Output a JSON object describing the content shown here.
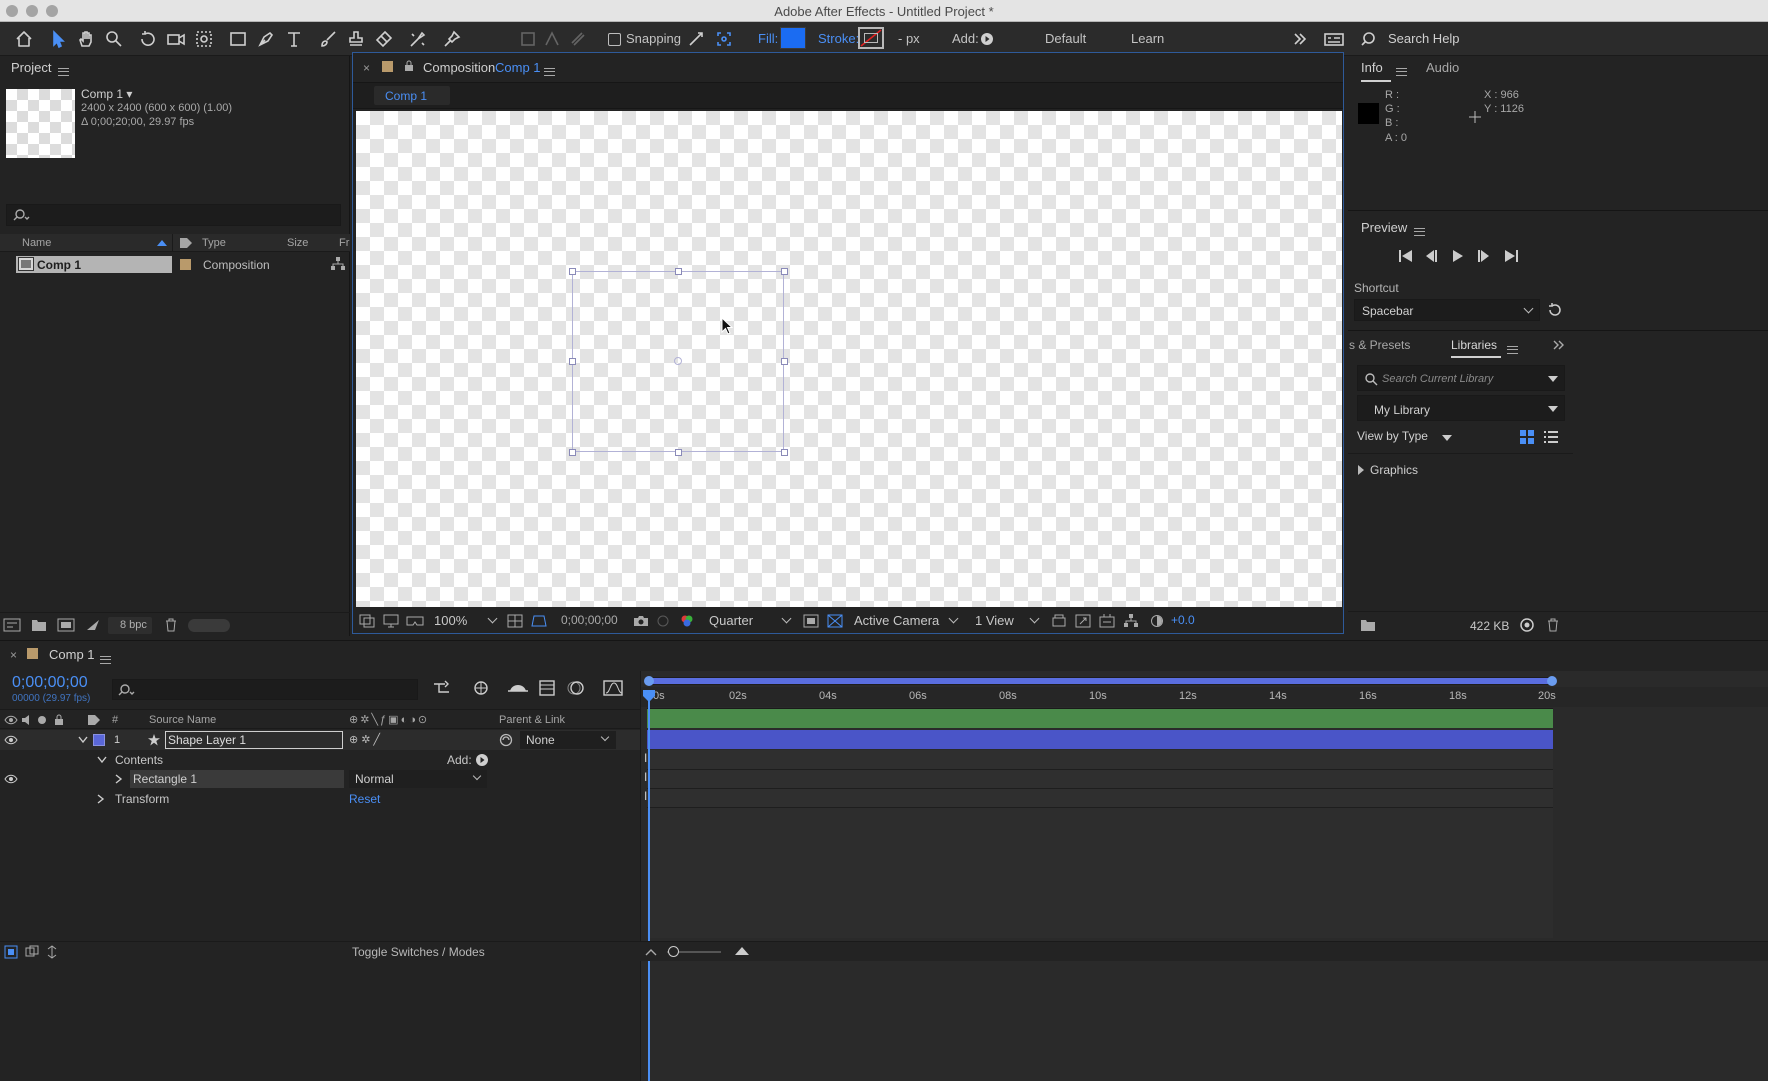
{
  "window": {
    "title": "Adobe After Effects - Untitled Project *"
  },
  "toolbar": {
    "snapping_label": "Snapping",
    "fill_label": "Fill:",
    "stroke_label": "Stroke:",
    "stroke_units": "- px",
    "add_label": "Add:",
    "workspace_default": "Default",
    "workspace_learn": "Learn",
    "search_placeholder": "Search Help",
    "fill_color": "#1b6cf2"
  },
  "project": {
    "panel_title": "Project",
    "item_name": "Comp 1 ▾",
    "item_dims": "2400 x 2400  (600 x 600) (1.00)",
    "item_duration": "Δ 0;00;20;00, 29.97 fps",
    "col_name": "Name",
    "col_type": "Type",
    "col_size": "Size",
    "col_fr": "Fr",
    "row_name": "Comp 1",
    "row_type": "Composition",
    "bpc": "8 bpc"
  },
  "composition": {
    "tab_prefix": "Composition",
    "tab_name": "Comp 1",
    "subtab": "Comp 1",
    "zoom": "100%",
    "timecode": "0;00;00;00",
    "resolution": "Quarter",
    "camera": "Active Camera",
    "views": "1 View",
    "exposure": "+0.0"
  },
  "info": {
    "tab_info": "Info",
    "tab_audio": "Audio",
    "r": "R :",
    "g": "G :",
    "b": "B :",
    "a": "A : 0",
    "x": "X : 966",
    "y": "Y : 1126"
  },
  "preview": {
    "title": "Preview",
    "shortcut_label": "Shortcut",
    "shortcut_value": "Spacebar"
  },
  "libraries": {
    "tab_effects": "s & Presets",
    "tab_libraries": "Libraries",
    "search_placeholder": "Search Current Library",
    "library_name": "My Library",
    "view_by": "View by Type",
    "graphics": "Graphics",
    "size": "422 KB"
  },
  "timeline": {
    "comp_tab": "Comp 1",
    "timecode": "0;00;00;00",
    "frames": "00000 (29.97 fps)",
    "col_num": "#",
    "col_source": "Source Name",
    "col_parent": "Parent & Link",
    "layer_num": "1",
    "layer_name": "Shape Layer 1",
    "parent_value": "None",
    "contents_label": "Contents",
    "add_label": "Add:",
    "rect_name": "Rectangle 1",
    "blend_mode": "Normal",
    "transform_label": "Transform",
    "reset_label": "Reset",
    "toggle_label": "Toggle Switches / Modes",
    "ruler": [
      "0s",
      "02s",
      "04s",
      "06s",
      "08s",
      "10s",
      "12s",
      "14s",
      "16s",
      "18s",
      "20s"
    ],
    "layer_color": "#4a55c8"
  }
}
